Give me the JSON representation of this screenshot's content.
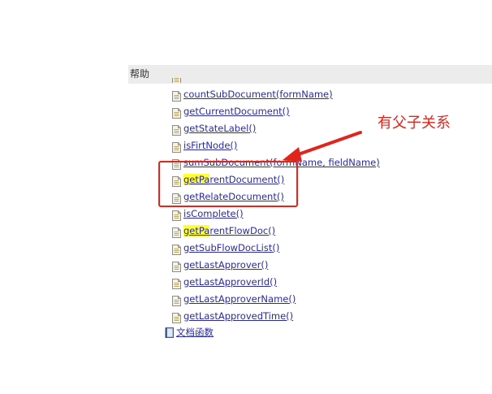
{
  "header": {
    "title": "帮助"
  },
  "functions": [
    {
      "name": "countSubDocument(formName)"
    },
    {
      "name": "getCurrentDocument()"
    },
    {
      "name": "getStateLabel()"
    },
    {
      "name": "isFirtNode()"
    },
    {
      "name": "sumSubDocument(formName, fieldName)"
    },
    {
      "name": "getParentDocument()",
      "highlight": "getPa",
      "rest": "rentDocument()"
    },
    {
      "name": "getRelateDocument()"
    },
    {
      "name": "isComplete()"
    },
    {
      "name": "getParentFlowDoc()",
      "highlight": "getPa",
      "rest": "rentFlowDoc()"
    },
    {
      "name": "getSubFlowDocList()"
    },
    {
      "name": "getLastApprover()"
    },
    {
      "name": "getLastApproverId()"
    },
    {
      "name": "getLastApproverName()"
    },
    {
      "name": "getLastApprovedTime()"
    }
  ],
  "section": {
    "label": "文档函数"
  },
  "annotation": {
    "text": "有父子关系",
    "color": "#e0251b"
  },
  "colors": {
    "link": "#2b2b9e",
    "highlight": "#ffff33",
    "header_bg": "#ececec"
  }
}
